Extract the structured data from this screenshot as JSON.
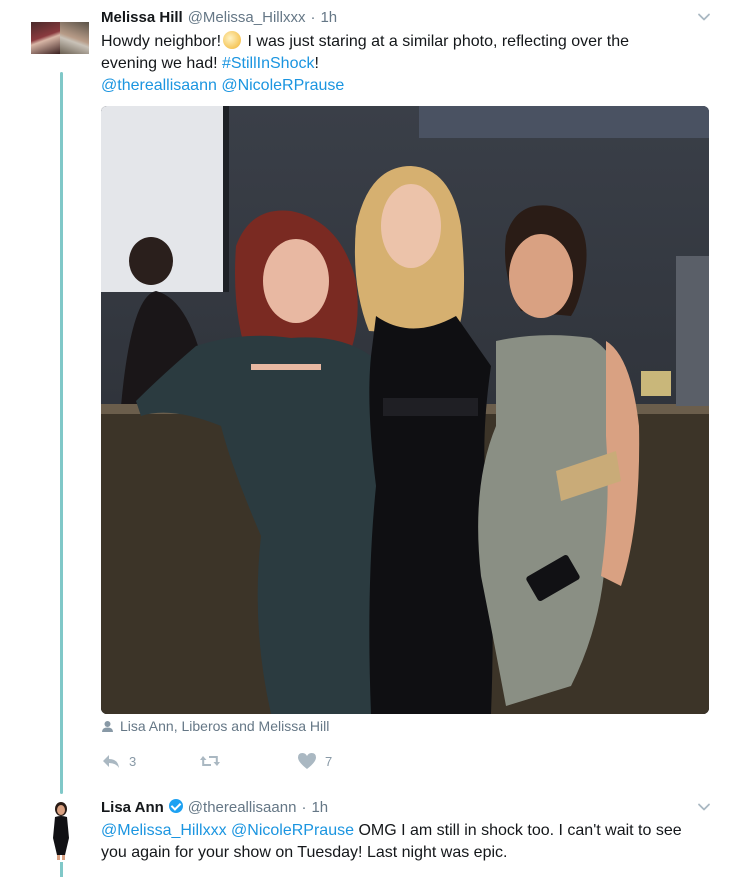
{
  "tweet1": {
    "name": "Melissa Hill",
    "handle": "@Melissa_Hillxxx",
    "dot": "·",
    "time": "1h",
    "text_a": "Howdy neighbor!",
    "text_b": " I was just staring at a similar photo, reflecting over the",
    "text_c": "evening we had! ",
    "hashtag": "#StillInShock",
    "text_d": "!",
    "mention1": "@thereallisaann",
    "mention2": "@NicoleRPrause",
    "tagged": "Lisa Ann, Liberos and Melissa Hill",
    "reply_count": "3",
    "retweet_count": "",
    "like_count": "7"
  },
  "tweet2": {
    "name": "Lisa Ann",
    "handle": "@thereallisaann",
    "dot": "·",
    "time": "1h",
    "mention1": "@Melissa_Hillxxx",
    "mention2": "@NicoleRPrause",
    "text_a": " OMG I am still in shock too. I can't wait to see",
    "text_b": "you again for your show on Tuesday! Last night was epic."
  },
  "icons": {
    "reply": "reply-icon",
    "retweet": "retweet-icon",
    "like": "heart-icon",
    "more": "chevron-down-icon",
    "verified": "verified-badge-icon",
    "person": "person-icon"
  },
  "colors": {
    "link": "#1b95e0",
    "thread_line": "#80c8c8",
    "muted": "#657786",
    "verified": "#1da1f2"
  }
}
